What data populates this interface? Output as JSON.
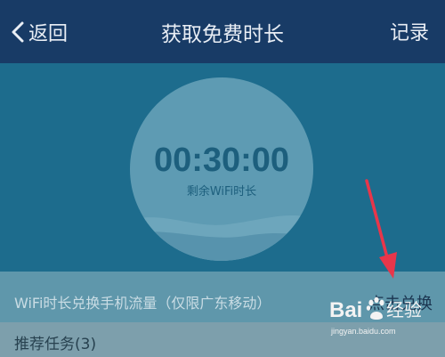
{
  "header": {
    "back_label": "返回",
    "title": "获取免费时长",
    "record_label": "记录"
  },
  "timer": {
    "value": "00:30:00",
    "label": "剩余WiFi时长"
  },
  "exchange": {
    "text": "WiFi时长兑换手机流量（仅限广东移动）",
    "button_label": "点击兑换"
  },
  "tasks": {
    "label": "推荐任务(3)"
  },
  "watermark": {
    "url": "jingyan.baidu.com"
  },
  "colors": {
    "header_bg": "#183b66",
    "hero_bg": "#1d6c8d",
    "circle": "#5e9bb3",
    "annotation_arrow": "#e8364a"
  }
}
